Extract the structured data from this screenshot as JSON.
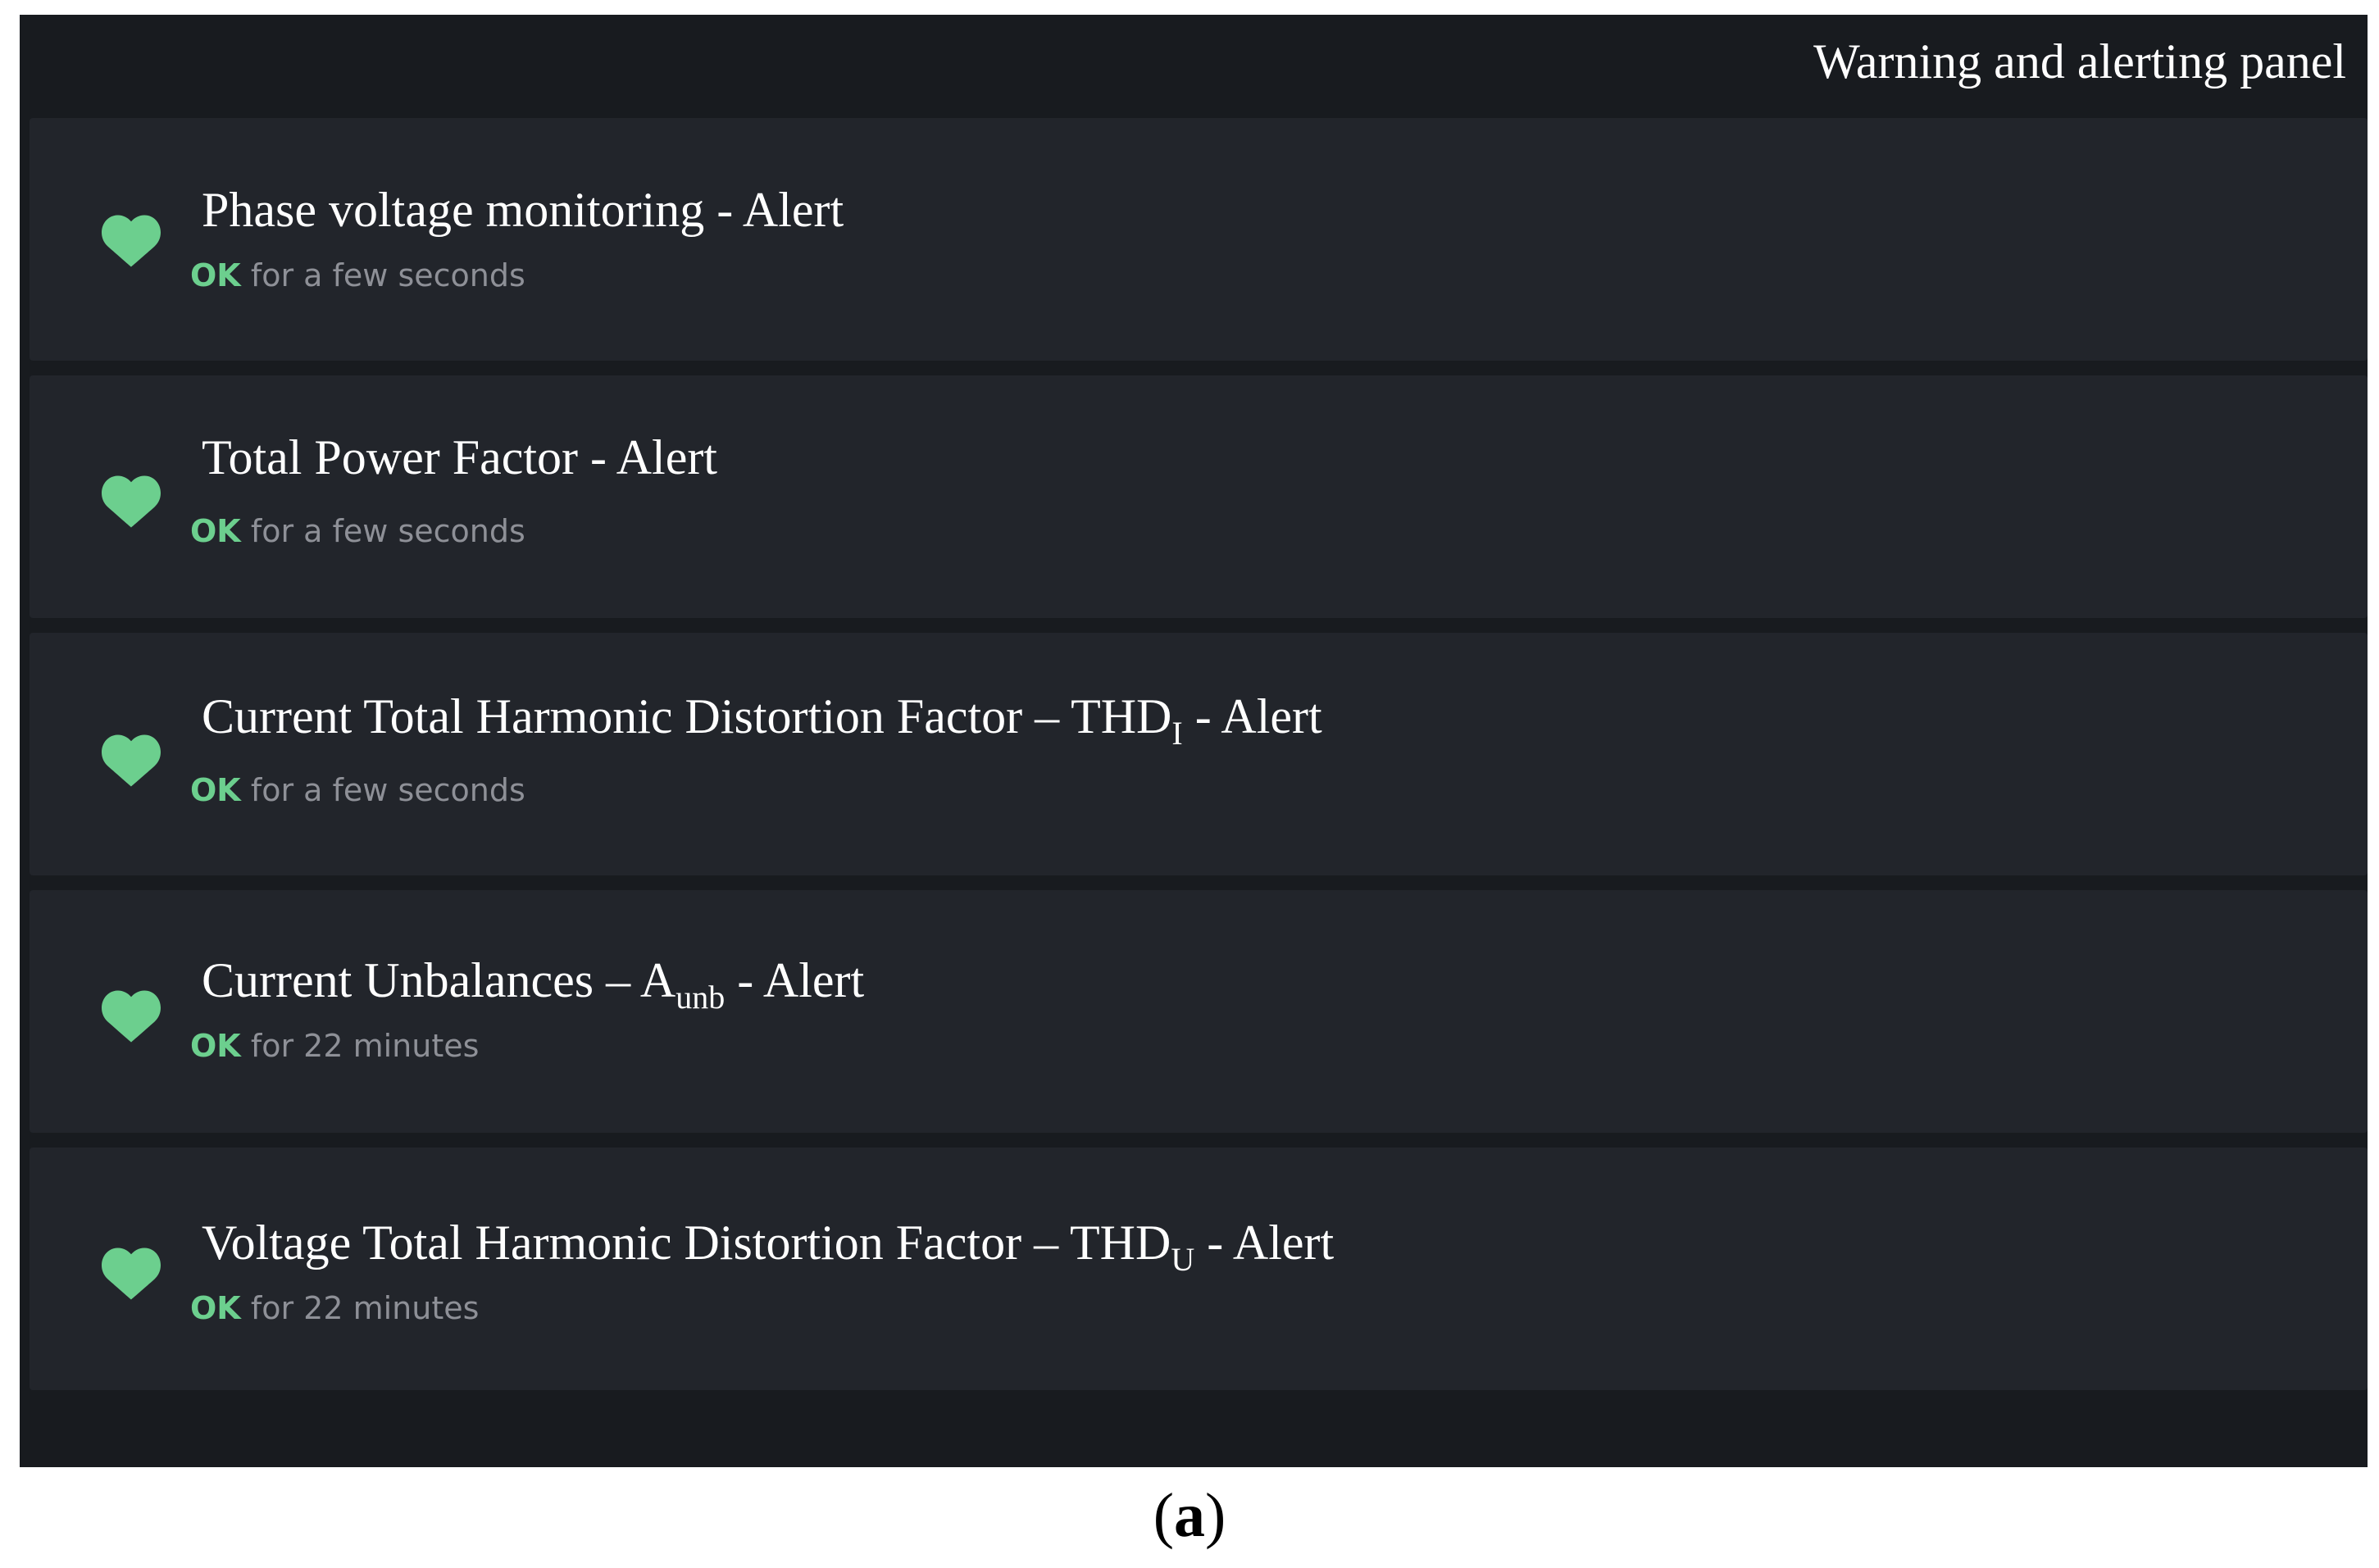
{
  "panel": {
    "title": "Warning and alerting panel"
  },
  "alerts": [
    {
      "title_main": "Phase voltage monitoring - Alert",
      "title_sub": "",
      "title_suffix": "",
      "state": "OK",
      "duration": "for a few seconds",
      "icon": "heart-icon"
    },
    {
      "title_main": "Total Power Factor - Alert",
      "title_sub": "",
      "title_suffix": "",
      "state": "OK",
      "duration": "for a few seconds",
      "icon": "heart-icon"
    },
    {
      "title_main": "Current Total Harmonic Distortion Factor – THD",
      "title_sub": "I",
      "title_suffix": " - Alert",
      "state": "OK",
      "duration": "for a few seconds",
      "icon": "heart-icon"
    },
    {
      "title_main": "Current Unbalances – A",
      "title_sub": "unb",
      "title_suffix": " - Alert",
      "state": "OK",
      "duration": "for 22 minutes",
      "icon": "heart-icon"
    },
    {
      "title_main": "Voltage Total Harmonic Distortion Factor – THD",
      "title_sub": "U",
      "title_suffix": " - Alert",
      "state": "OK",
      "duration": "for 22 minutes",
      "icon": "heart-icon"
    }
  ],
  "colors": {
    "panel_background": "#181b1f",
    "item_background": "#22252b",
    "ok_green": "#6ccf8e",
    "muted_text": "#8e9097"
  },
  "caption": {
    "open": "(",
    "label": "a",
    "close": ")"
  }
}
